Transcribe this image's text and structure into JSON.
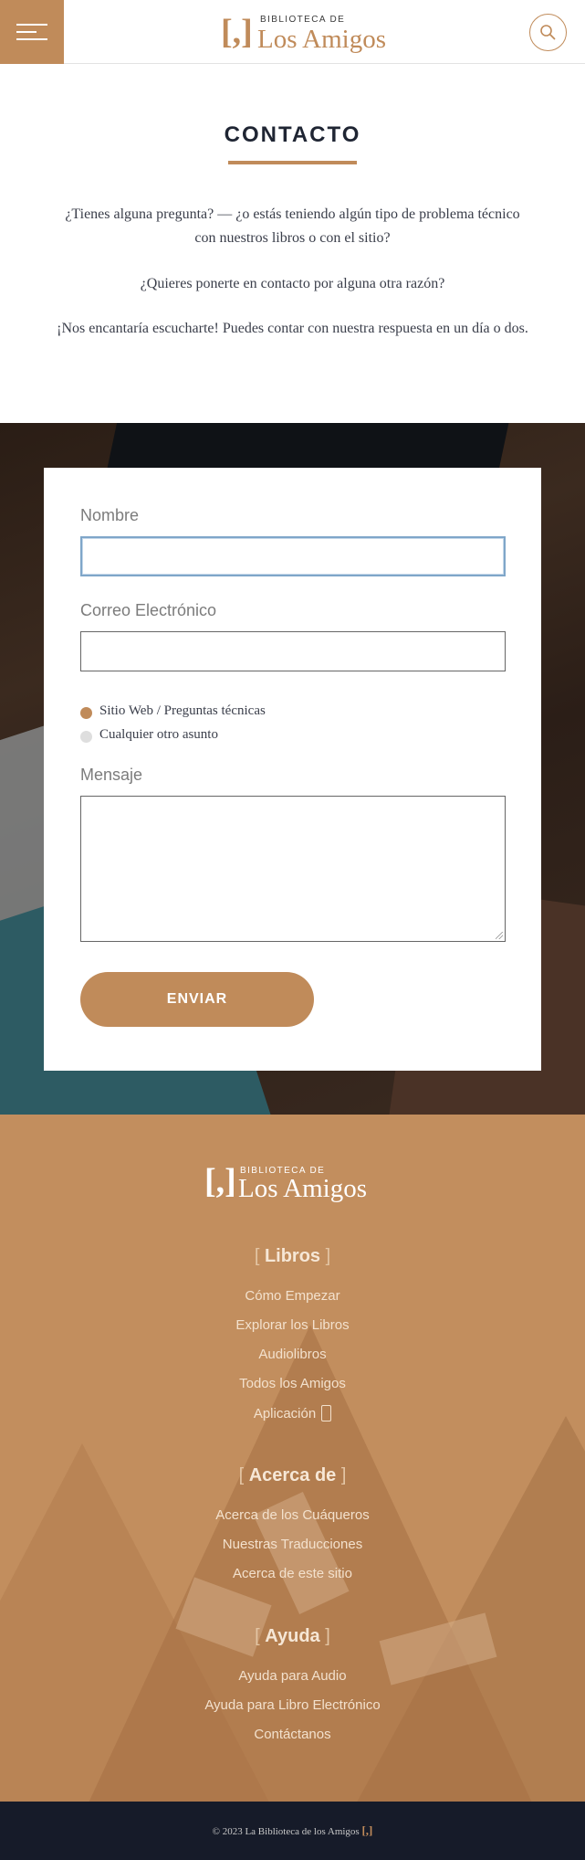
{
  "header": {
    "logo_small": "BIBLIOTECA DE",
    "logo_big": "Los Amigos",
    "logo_bracket": "[,]",
    "menu_icon": "hamburger-icon",
    "search_icon": "search-icon"
  },
  "intro": {
    "title": "CONTACTO",
    "paragraph1": "¿Tienes alguna pregunta? — ¿o estás teniendo algún tipo de problema técnico con nuestros libros o con el sitio?",
    "paragraph2": "¿Quieres ponerte en contacto por alguna otra razón?",
    "paragraph3": "¡Nos encantaría escucharte! Puedes contar con nuestra respuesta en un día o dos."
  },
  "form": {
    "name_label": "Nombre",
    "name_value": "",
    "email_label": "Correo Electrónico",
    "email_value": "",
    "radio_options": [
      {
        "label": "Sitio Web / Preguntas técnicas",
        "selected": true
      },
      {
        "label": "Cualquier otro asunto",
        "selected": false
      }
    ],
    "message_label": "Mensaje",
    "message_value": "",
    "submit_label": "ENVIAR"
  },
  "footer": {
    "logo_small": "BIBLIOTECA DE",
    "logo_big": "Los Amigos",
    "logo_bracket": "[,]",
    "sections": [
      {
        "title": "Libros",
        "links": [
          "Cómo Empezar",
          "Explorar los Libros",
          "Audiolibros",
          "Todos los Amigos",
          "Aplicación"
        ]
      },
      {
        "title": "Acerca de",
        "links": [
          "Acerca de los Cuáqueros",
          "Nuestras Traducciones",
          "Acerca de este sitio"
        ]
      },
      {
        "title": "Ayuda",
        "links": [
          "Ayuda para Audio",
          "Ayuda para Libro Electrónico",
          "Contáctanos"
        ]
      }
    ],
    "copyright": "© 2023 La Biblioteca de los Amigos",
    "copyright_mark": "[,]"
  },
  "colors": {
    "accent": "#c08b5a",
    "footer_bg": "#c28e5e",
    "bottom_bar": "#161b29"
  }
}
